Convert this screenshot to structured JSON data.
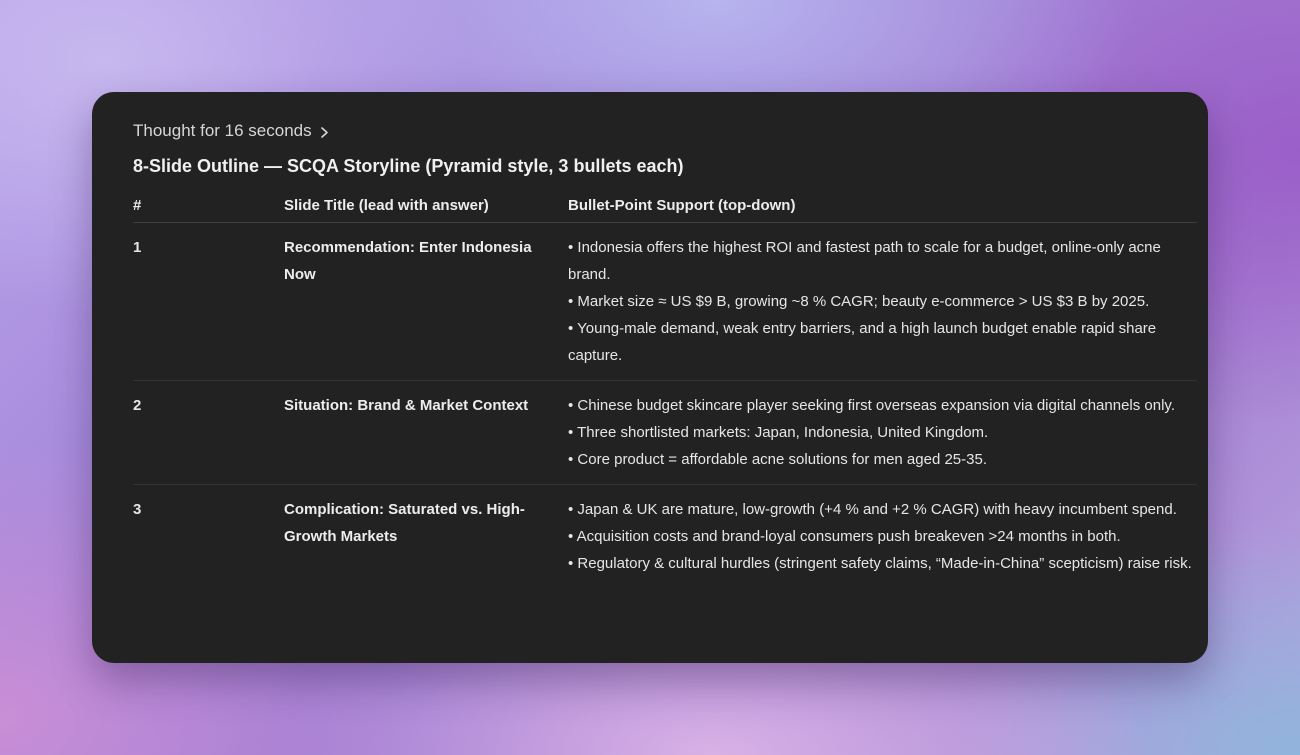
{
  "thought": {
    "label": "Thought for 16 seconds",
    "icon": "chevron-right-icon"
  },
  "heading": "8-Slide Outline — SCQA Storyline (Pyramid style, 3 bullets each)",
  "table": {
    "columns": [
      "#",
      "Slide Title (lead with answer)",
      "Bullet-Point Support (top-down)"
    ],
    "rows": [
      {
        "num": "1",
        "title": "Recommendation: Enter Indonesia Now",
        "bullets": [
          "• Indonesia offers the highest ROI and fastest path to scale for a budget, online-only acne brand.",
          "• Market size ≈ US $9 B, growing ~8 % CAGR; beauty e-commerce > US $3 B by 2025.",
          "• Young-male demand, weak entry barriers, and a high launch budget enable rapid share capture."
        ]
      },
      {
        "num": "2",
        "title": "Situation: Brand & Market Context",
        "bullets": [
          "• Chinese budget skincare player seeking first overseas expansion via digital channels only.",
          "• Three shortlisted markets: Japan, Indonesia, United Kingdom.",
          "• Core product = affordable acne solutions for men aged 25-35."
        ]
      },
      {
        "num": "3",
        "title": "Complication: Saturated vs. High-Growth Markets",
        "bullets": [
          "• Japan & UK are mature, low-growth (+4 % and +2 % CAGR) with heavy incumbent spend.",
          "• Acquisition costs and brand-loyal consumers push breakeven >24 months in both.",
          "• Regulatory & cultural hurdles (stringent safety claims, “Made-in-China” scepticism) raise risk."
        ]
      }
    ]
  }
}
